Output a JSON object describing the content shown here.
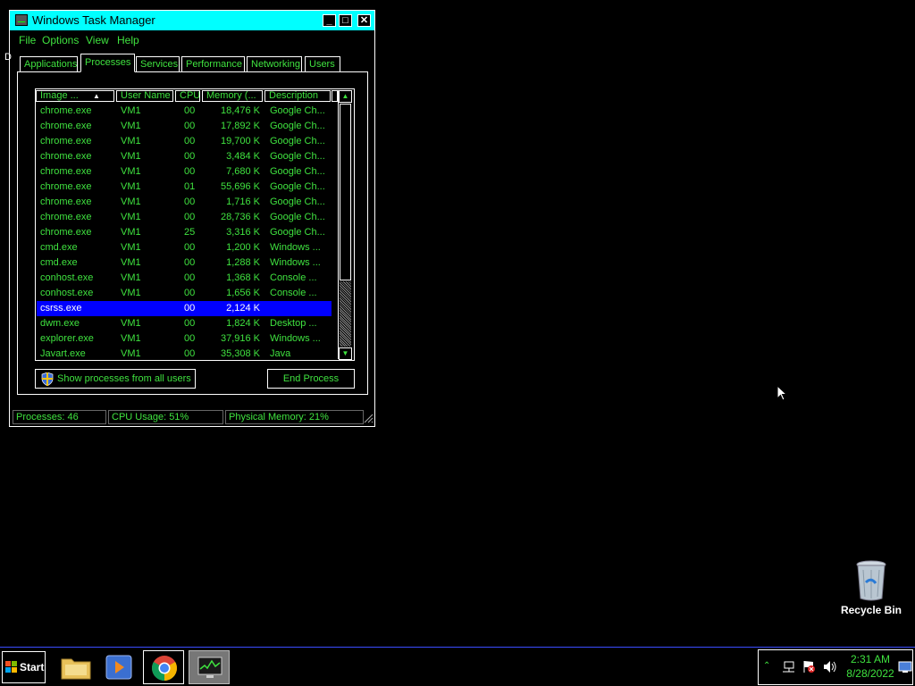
{
  "window": {
    "title": "Windows Task Manager",
    "menu": [
      "File",
      "Options",
      "View",
      "Help"
    ],
    "tabs": [
      "Applications",
      "Processes",
      "Services",
      "Performance",
      "Networking",
      "Users"
    ],
    "active_tab": "Processes"
  },
  "table": {
    "columns": [
      "Image ...",
      "User Name",
      "CPU",
      "Memory (...",
      "Description"
    ],
    "sort_indicator": "▲",
    "rows": [
      {
        "image": "chrome.exe",
        "user": "VM1",
        "cpu": "00",
        "memory": "18,476 K",
        "desc": "Google Ch..."
      },
      {
        "image": "chrome.exe",
        "user": "VM1",
        "cpu": "00",
        "memory": "17,892 K",
        "desc": "Google Ch..."
      },
      {
        "image": "chrome.exe",
        "user": "VM1",
        "cpu": "00",
        "memory": "19,700 K",
        "desc": "Google Ch..."
      },
      {
        "image": "chrome.exe",
        "user": "VM1",
        "cpu": "00",
        "memory": "3,484 K",
        "desc": "Google Ch..."
      },
      {
        "image": "chrome.exe",
        "user": "VM1",
        "cpu": "00",
        "memory": "7,680 K",
        "desc": "Google Ch..."
      },
      {
        "image": "chrome.exe",
        "user": "VM1",
        "cpu": "01",
        "memory": "55,696 K",
        "desc": "Google Ch..."
      },
      {
        "image": "chrome.exe",
        "user": "VM1",
        "cpu": "00",
        "memory": "1,716 K",
        "desc": "Google Ch..."
      },
      {
        "image": "chrome.exe",
        "user": "VM1",
        "cpu": "00",
        "memory": "28,736 K",
        "desc": "Google Ch..."
      },
      {
        "image": "chrome.exe",
        "user": "VM1",
        "cpu": "25",
        "memory": "3,316 K",
        "desc": "Google Ch..."
      },
      {
        "image": "cmd.exe",
        "user": "VM1",
        "cpu": "00",
        "memory": "1,200 K",
        "desc": "Windows ..."
      },
      {
        "image": "cmd.exe",
        "user": "VM1",
        "cpu": "00",
        "memory": "1,288 K",
        "desc": "Windows ..."
      },
      {
        "image": "conhost.exe",
        "user": "VM1",
        "cpu": "00",
        "memory": "1,368 K",
        "desc": "Console ..."
      },
      {
        "image": "conhost.exe",
        "user": "VM1",
        "cpu": "00",
        "memory": "1,656 K",
        "desc": "Console ..."
      },
      {
        "image": "csrss.exe",
        "user": "",
        "cpu": "00",
        "memory": "2,124 K",
        "desc": "",
        "selected": true
      },
      {
        "image": "dwm.exe",
        "user": "VM1",
        "cpu": "00",
        "memory": "1,824 K",
        "desc": "Desktop ..."
      },
      {
        "image": "explorer.exe",
        "user": "VM1",
        "cpu": "00",
        "memory": "37,916 K",
        "desc": "Windows ..."
      },
      {
        "image": "Javart.exe",
        "user": "VM1",
        "cpu": "00",
        "memory": "35,308 K",
        "desc": "Java"
      }
    ]
  },
  "buttons": {
    "show_all": "Show processes from all users",
    "end_process": "End Process"
  },
  "status": {
    "processes": "Processes: 46",
    "cpu": "CPU Usage: 51%",
    "memory": "Physical Memory: 21%"
  },
  "taskbar": {
    "start_label": "Start",
    "time": "2:31 AM",
    "date": "8/28/2022"
  },
  "desktop": {
    "recycle_bin_label": "Recycle Bin"
  },
  "colors": {
    "accent_text": "#3fe23f",
    "titlebar": "#00ffff",
    "selection": "#0000ff"
  }
}
